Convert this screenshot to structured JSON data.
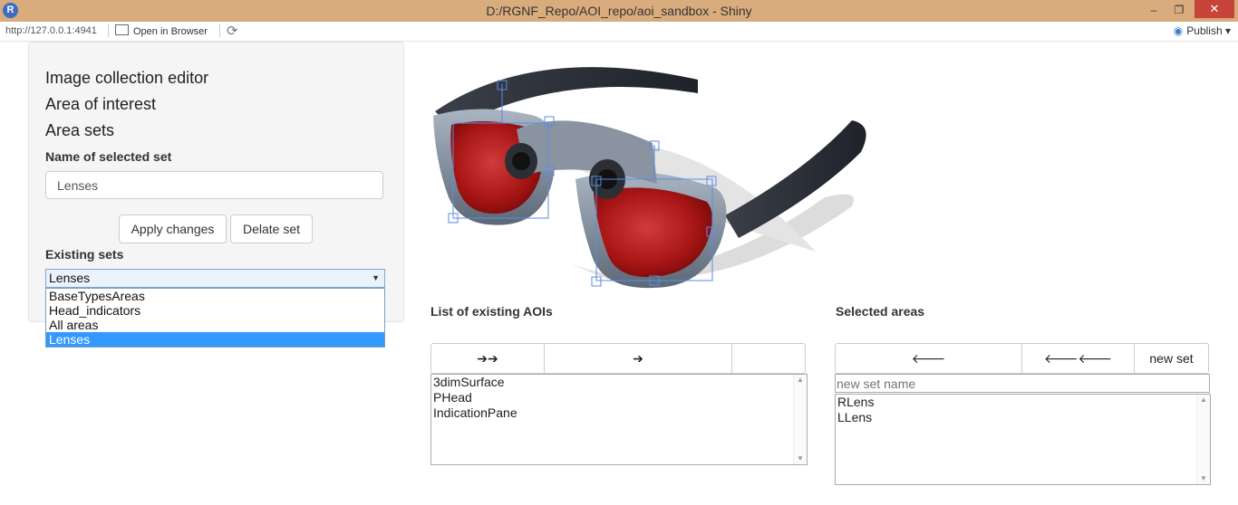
{
  "window": {
    "title": "D:/RGNF_Repo/AOI_repo/aoi_sandbox - Shiny",
    "app_icon": "R",
    "controls": {
      "minimize": "–",
      "maximize": "❐",
      "close": "✕"
    }
  },
  "toolbar": {
    "url": "http://127.0.0.1:4941",
    "open_browser": "Open in Browser",
    "publish": "Publish"
  },
  "sidebar": {
    "menu": [
      "Image collection editor",
      "Area of interest",
      "Area sets"
    ],
    "name_label": "Name of selected set",
    "name_value": "Lenses",
    "apply_button": "Apply changes",
    "delete_button": "Delate set",
    "existing_label": "Existing sets",
    "selected_set": "Lenses",
    "options": [
      "BaseTypesAreas",
      "Head_indicators",
      "All areas",
      "Lenses"
    ]
  },
  "aoi_list": {
    "label": "List of existing AOIs",
    "btn_move_all": "➔➔",
    "btn_move_one": "➔",
    "btn_blank": "",
    "items": [
      "3dimSurface",
      "PHead",
      "IndicationPane"
    ]
  },
  "selected": {
    "label": "Selected areas",
    "btn_remove_one": "🡐",
    "btn_remove_all": "🡐🡐",
    "btn_new_set": "new set",
    "new_set_placeholder": "new set name",
    "items": [
      "RLens",
      "LLens"
    ]
  },
  "colors": {
    "sidebar_bg": "#f5f5f5",
    "selection": "#3399ff",
    "titlebar": "#d9ac7e"
  }
}
